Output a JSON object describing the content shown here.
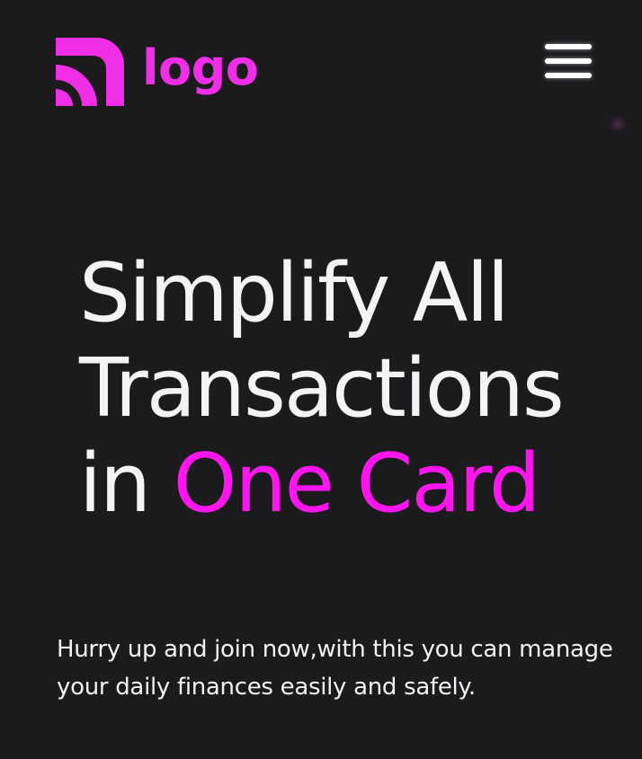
{
  "header": {
    "logo_text": "logo",
    "menu_icon": "hamburger-menu-icon",
    "logo_icon": "wireless-signal-logo-icon"
  },
  "hero": {
    "title_line1": "Simplify All",
    "title_line2": "Transactions",
    "title_line3_prefix": "in",
    "title_line3_accent": "One Card",
    "subtitle": "Hurry up and join now,with this you can manage your daily finances easily and safely."
  },
  "colors": {
    "background": "#1b1a1d",
    "accent": "#ff16ee",
    "logo": "#ef2ee6",
    "text": "#f4f4f6"
  }
}
